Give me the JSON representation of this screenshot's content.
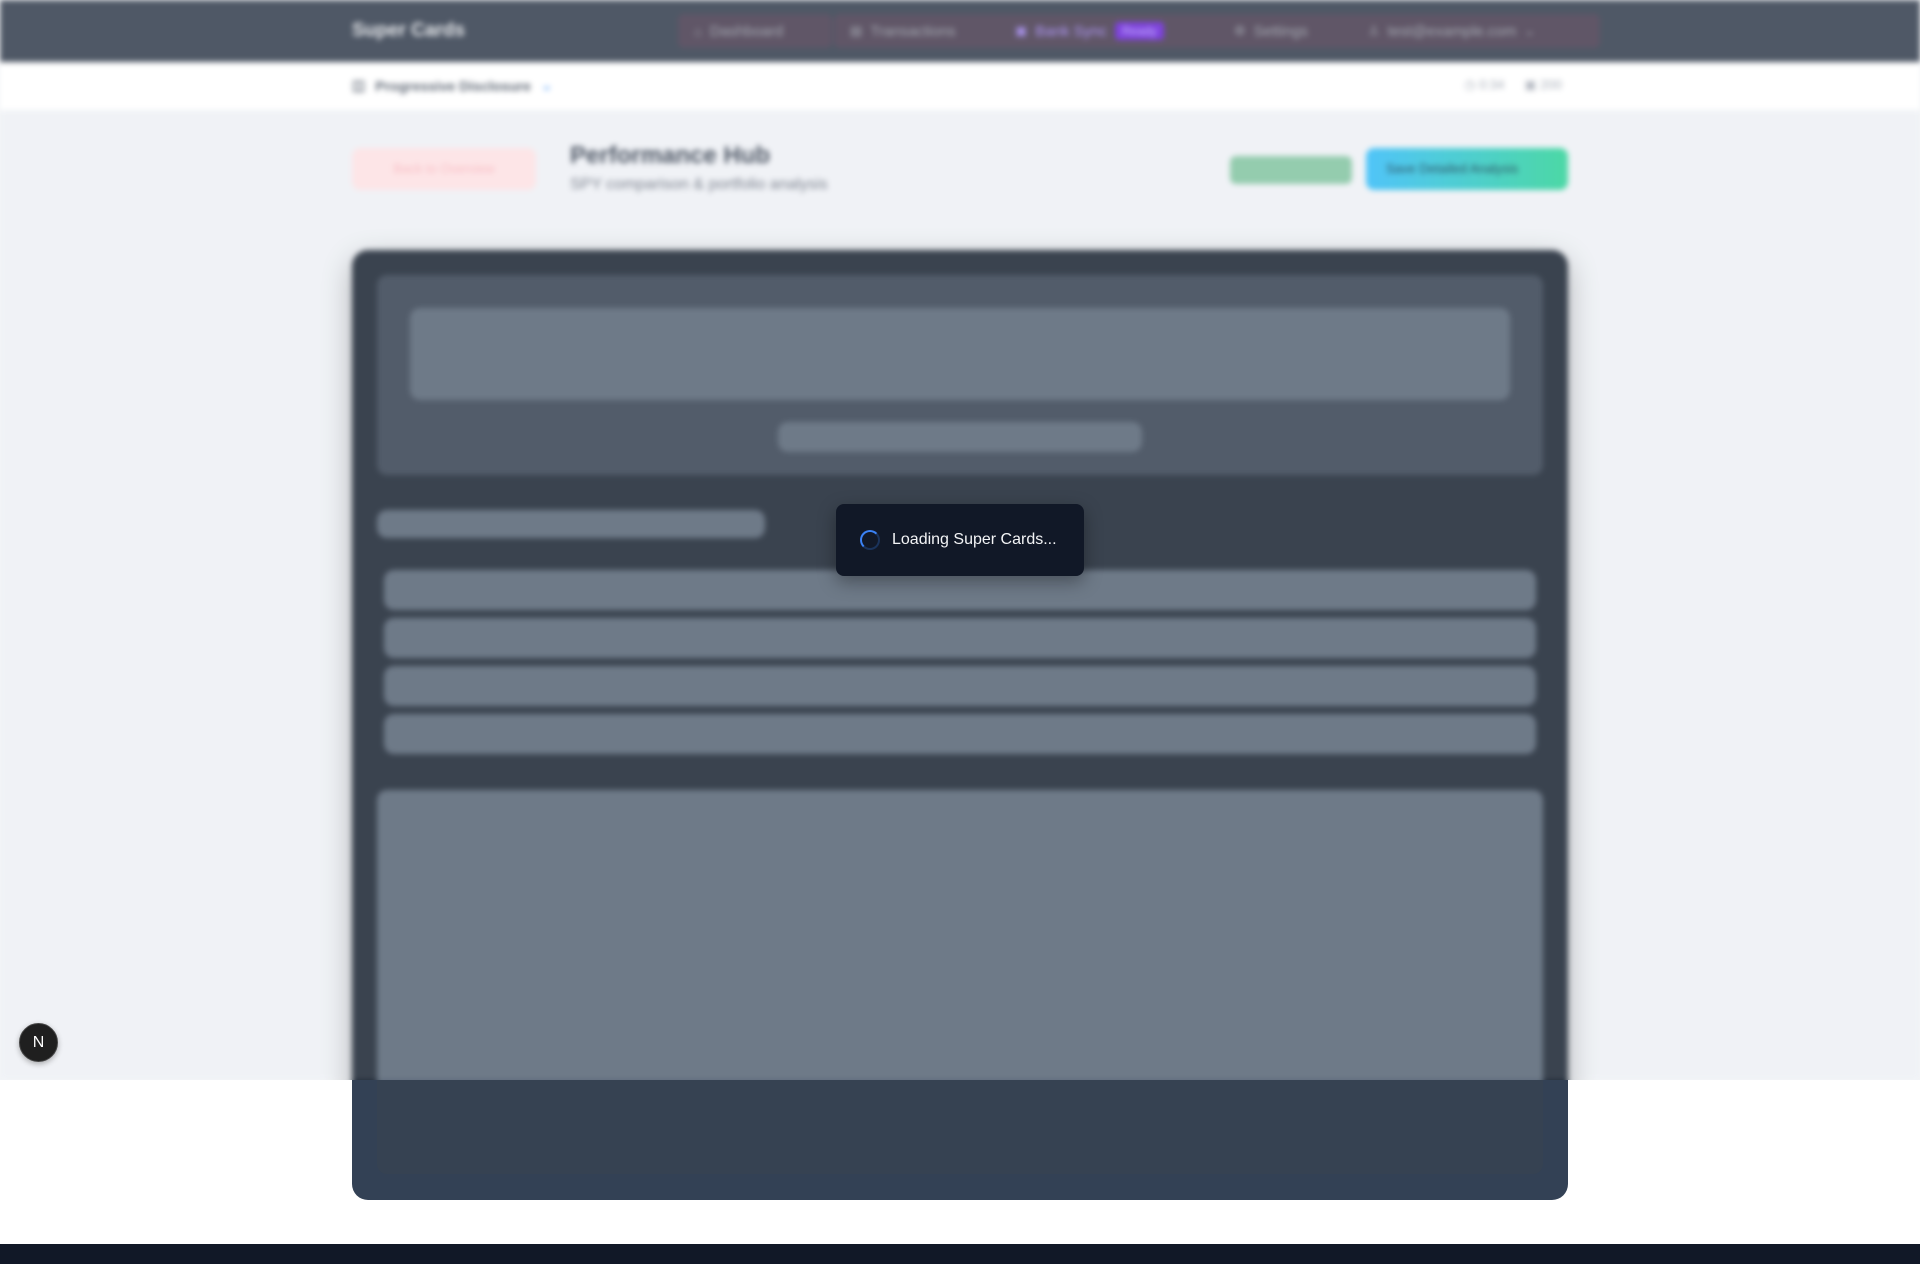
{
  "header": {
    "brand": "Super Cards",
    "nav": [
      {
        "label": "Dashboard",
        "icon": "home-icon"
      },
      {
        "label": "Transactions",
        "icon": "list-icon"
      },
      {
        "label": "Bank Sync",
        "icon": "bank-icon",
        "badge": "Ready"
      },
      {
        "label": "Settings",
        "icon": "gear-icon"
      },
      {
        "label": "test@example.com",
        "icon": "user-icon"
      }
    ]
  },
  "subbar": {
    "left_label": "Progressive Disclosure",
    "right_time": "0:34",
    "right_count": "200"
  },
  "page": {
    "back_label": "Back to Overview",
    "title": "Performance Hub",
    "subtitle": "SPY comparison & portfolio analysis",
    "cta_label": "Save Detailed Analysis"
  },
  "toast": {
    "message": "Loading Super Cards..."
  },
  "dev_badge": {
    "label": "N"
  },
  "colors": {
    "topbar": "#374151",
    "spinner": "#3b82f6",
    "toast_bg": "#111827"
  }
}
